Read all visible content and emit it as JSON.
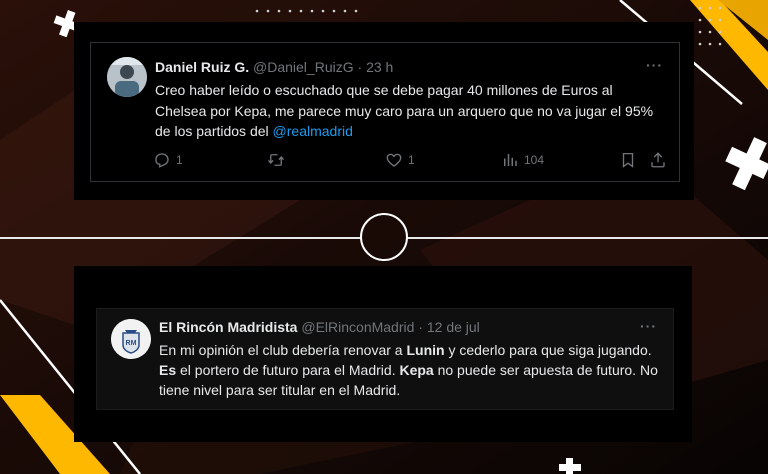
{
  "colors": {
    "background": "#0c0605",
    "accent_yellow": "#ffb800",
    "link": "#1d9bf0",
    "text": "#e7e9ea",
    "muted": "#71767b"
  },
  "tweet1": {
    "name": "Daniel Ruiz G.",
    "handle": "@Daniel_RuizG",
    "separator": "·",
    "time": "23 h",
    "more": "···",
    "text_before_link": "Creo haber leído o escuchado que se debe pagar 40 millones de Euros al Chelsea por Kepa, me parece muy caro para un arquero que no va jugar el 95% de los partidos del ",
    "link": "@realmadrid",
    "actions": {
      "replies": "1",
      "retweets": "",
      "likes": "1",
      "views": "104"
    },
    "icons": [
      "reply-icon",
      "retweet-icon",
      "like-icon",
      "views-icon",
      "bookmark-icon",
      "share-icon"
    ]
  },
  "tweet2": {
    "name": "El Rincón Madridista",
    "handle": "@ElRinconMadrid",
    "separator": "·",
    "time": "12 de jul",
    "more": "···",
    "text_parts": [
      {
        "text": "En mi opinión el club debería renovar a ",
        "bold": false
      },
      {
        "text": "Lunin",
        "bold": true
      },
      {
        "text": " y cederlo para que siga jugando. ",
        "bold": false
      },
      {
        "text": "Es",
        "bold": true
      },
      {
        "text": " el portero de futuro para el Madrid. ",
        "bold": false
      },
      {
        "text": "Kepa",
        "bold": true
      },
      {
        "text": " no puede ser apuesta de futuro. No tiene nivel para ser titular en el Madrid.",
        "bold": false
      }
    ]
  }
}
